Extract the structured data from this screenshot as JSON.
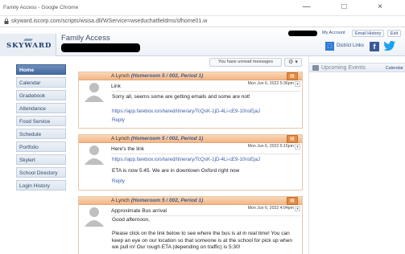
{
  "window": {
    "title": "Family Access - Google Chrome",
    "controls": "— □ ×",
    "url": "skyward.iscorp.com/scripts/wsisa.dll/WService=wseduchatfieldms/sfhome01.w"
  },
  "header": {
    "logo": "SKYWARD",
    "app_title": "Family Access",
    "my_account": "My Account",
    "email_history": "Email History",
    "exit": "Exit",
    "district_links": "District Links",
    "facebook": "f",
    "twitter": "🐦"
  },
  "sidebar": {
    "items": [
      {
        "label": "Home",
        "active": true
      },
      {
        "label": "Calendar"
      },
      {
        "label": "Gradebook"
      },
      {
        "label": "Attendance"
      },
      {
        "label": "Food Service"
      },
      {
        "label": "Schedule"
      },
      {
        "label": "Portfolio"
      },
      {
        "label": "Skylert"
      },
      {
        "label": "School Directory"
      },
      {
        "label": "Login History"
      }
    ]
  },
  "main": {
    "unread_label": "You have unread messages",
    "gear": "⚙ ▾",
    "messages": [
      {
        "from": "A Lynch",
        "class": "(Homeroom 5 / 002, Period 1)",
        "subject": "Link",
        "date": "Mon Jun 6, 2022 5:36pm",
        "body": "Sorry all, seems some are getting emails and some are not!",
        "link": "https://app.farebox.io/shared/itinerary/TcQsK-1jD-4Li-cE9-10nsEjaJ",
        "reply": "Reply"
      },
      {
        "from": "A Lynch",
        "class": "(Homeroom 5 / 002, Period 1)",
        "subject": "Here's the link",
        "date": "Mon Jun 6, 2022 5:15pm",
        "link": "https://app.farebox.io/shared/itinerary/TcQsK-1jD-4Li-cE9-10nsEjaJ",
        "body": "ETA is now 5:45. We are in downtown Oxford right now",
        "reply": "Reply"
      },
      {
        "from": "A Lynch",
        "class": "(Homeroom 5 / 002, Period 1)",
        "subject": "Approximate Bus arrival",
        "date": "Mon Jun 6, 2022 4:04pm",
        "greeting": "Good afternoon,",
        "body": "Please click on the link below to see where the bus is at in real time! You can keep an eye on our location so that someone is at the school for pick up when we pull in! Our rough ETA (depending on traffic) is 5:30!"
      }
    ]
  },
  "right_panel": {
    "title": "Upcoming Events",
    "calendar_link": "Calendar"
  }
}
